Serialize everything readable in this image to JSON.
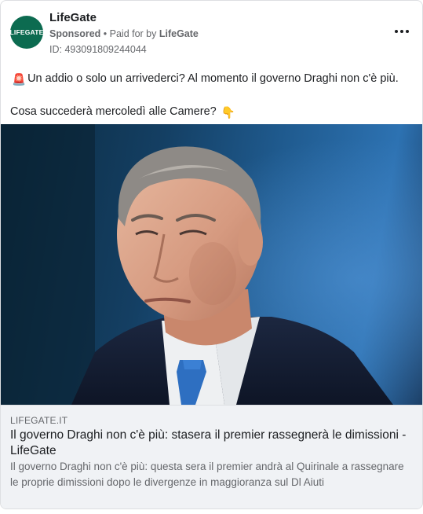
{
  "page": {
    "name": "LifeGate",
    "avatar_text": "LIFEGATE",
    "sponsored_label": "Sponsored",
    "separator": " • ",
    "paid_for_prefix": "Paid for by ",
    "paid_for_by": "LifeGate",
    "ad_id": "ID: 493091809244044"
  },
  "post": {
    "line1_emoji": "🚨",
    "line1_text": "Un addio o solo un arrivederci? Al momento il governo Draghi non c'è più.",
    "line2_text": "Cosa succederà mercoledì alle Camere?",
    "line2_emoji": "👇"
  },
  "link_preview": {
    "domain": "LIFEGATE.IT",
    "title": "Il governo Draghi non c'è più: stasera il premier rassegnerà le dimissioni - LifeGate",
    "description": "Il governo Draghi non c'è più: questa sera il premier andrà al Quirinale a rassegnare le proprie dimissioni dopo le divergenze in maggioranza sul Dl Aiuti"
  },
  "icons": {
    "more": "more-options-icon"
  },
  "colors": {
    "brand_green": "#0c6b50",
    "secondary_text": "#65676b",
    "link_box_bg": "#f0f2f5"
  }
}
